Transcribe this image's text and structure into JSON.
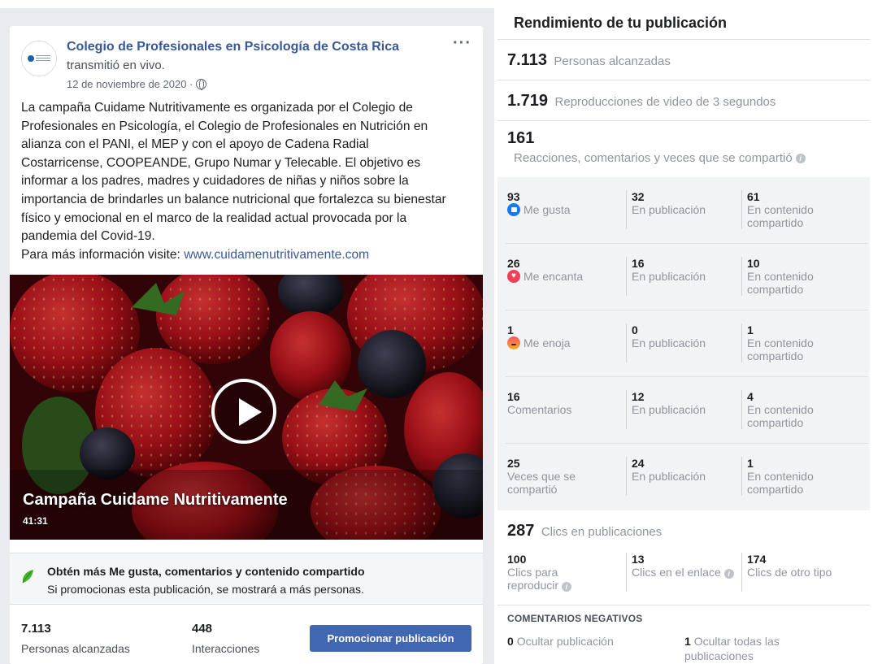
{
  "post": {
    "page_name": "Colegio de Profesionales en Psicología de Costa Rica",
    "action": "transmitió en vivo.",
    "date": "12 de noviembre de 2020 ·",
    "more_icon": "more-icon",
    "text_lines": [
      "La campaña Cuidame Nutritivamente es organizada por el Colegio de",
      "Profesionales en Psicología, el Colegio de Profesionales en Nutrición en",
      "alianza con el PANI, el MEP y con el apoyo de Cadena Radial",
      "Costarricense, COOPEANDE, Grupo Numar y Telecable. El objetivo es",
      "informar a los padres, madres y cuidadores de niñas y niños sobre la",
      "importancia de brindarles un balance nutricional que fortalezca su bienestar",
      "físico y emocional en el marco de la realidad actual provocada por la",
      "pandemia del Covid-19."
    ],
    "more_info_prefix": "Para más información visite: ",
    "link": "www.cuidamenutritivamente.com",
    "video_title": "Campaña Cuidame Nutritivamente",
    "video_duration": "41:31",
    "promo_title": "Obtén más Me gusta, comentarios y contenido compartido",
    "promo_sub": "Si promocionas esta publicación, se mostrará a más personas.",
    "reach_value": "7.113",
    "reach_label": "Personas alcanzadas",
    "interactions_value": "448",
    "interactions_label": "Interacciones",
    "boost_button": "Promocionar publicación"
  },
  "insights": {
    "title": "Rendimiento de tu publicación",
    "reach": {
      "value": "7.113",
      "label": "Personas alcanzadas"
    },
    "views": {
      "value": "1.719",
      "label": "Reproducciones de video de 3 segundos"
    },
    "engagement": {
      "value": "161",
      "label": "Reacciones, comentarios y veces que se compartió"
    },
    "rows": [
      {
        "value": "93",
        "label": "Me gusta",
        "icon": "like-icon",
        "post_value": "32",
        "post_label": "En publicación",
        "shared_value": "61",
        "shared_label": "En contenido compartido"
      },
      {
        "value": "26",
        "label": "Me encanta",
        "icon": "love-icon",
        "post_value": "16",
        "post_label": "En publicación",
        "shared_value": "10",
        "shared_label": "En contenido compartido"
      },
      {
        "value": "1",
        "label": "Me enoja",
        "icon": "angry-icon",
        "post_value": "0",
        "post_label": "En publicación",
        "shared_value": "1",
        "shared_label": "En contenido compartido"
      },
      {
        "value": "16",
        "label": "Comentarios",
        "post_value": "12",
        "post_label": "En publicación",
        "shared_value": "4",
        "shared_label": "En contenido compartido"
      },
      {
        "value": "25",
        "label": "Veces que se compartió",
        "post_value": "24",
        "post_label": "En publicación",
        "shared_value": "1",
        "shared_label": "En contenido compartido"
      }
    ],
    "clicks": {
      "value": "287",
      "label": "Clics en publicaciones"
    },
    "click_breakdown": [
      {
        "value": "100",
        "label": "Clics para reproducir"
      },
      {
        "value": "13",
        "label": "Clics en el enlace"
      },
      {
        "value": "174",
        "label": "Clics de otro tipo"
      }
    ],
    "negative_title": "COMENTARIOS NEGATIVOS",
    "hide_post": {
      "value": "0",
      "label": "Ocultar publicación"
    },
    "hide_all": {
      "value": "1",
      "label": "Ocultar todas las publicaciones"
    },
    "info_symbol": "i"
  }
}
